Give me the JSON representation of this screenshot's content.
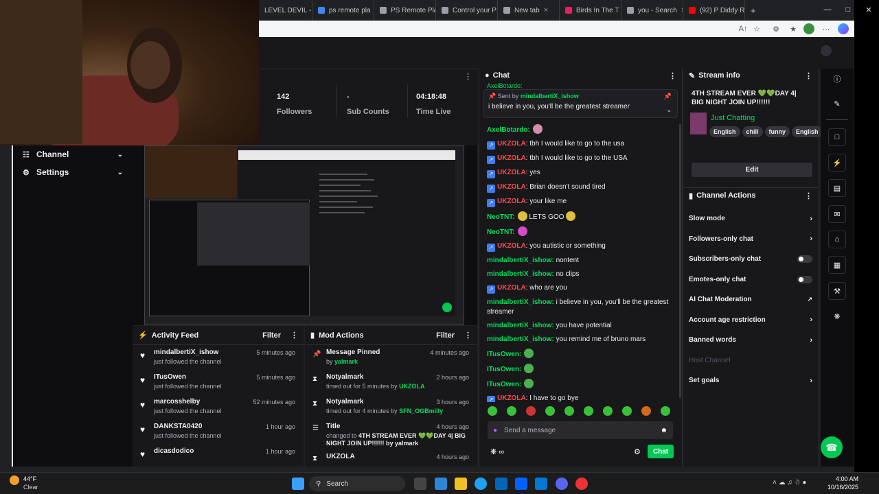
{
  "browser": {
    "tabs": [
      {
        "label": "LEVEL DEVIL -",
        "color": "#e5534b"
      },
      {
        "label": "ps remote pla",
        "color": "#4285f4"
      },
      {
        "label": "PS Remote Pla",
        "color": "#9aa0a6"
      },
      {
        "label": "Control your P",
        "color": "#9aa0a6"
      },
      {
        "label": "New tab",
        "color": "#9aa0a6"
      },
      {
        "label": "Birds In The T",
        "color": "#e91e63"
      },
      {
        "label": "you - Search",
        "color": "#9aa0a6"
      },
      {
        "label": "(92) P Diddy R",
        "color": "#ff0000"
      }
    ]
  },
  "stats": {
    "followers": {
      "value": "142",
      "label": "Followers"
    },
    "subs": {
      "value": "-",
      "label": "Sub Counts"
    },
    "time": {
      "value": "04:18:48",
      "label": "Time Live"
    }
  },
  "leftnav": {
    "channel": "Channel",
    "settings": "Settings"
  },
  "activity": {
    "title": "Activity Feed",
    "filter": "Filter",
    "items": [
      {
        "name": "mindalbertiX_ishow",
        "sub": "just followed the channel",
        "time": "5 minutes ago"
      },
      {
        "name": "ITusOwen",
        "sub": "just followed the channel",
        "time": "5 minutes ago"
      },
      {
        "name": "marcosshelby",
        "sub": "just followed the channel",
        "time": "52 minutes ago"
      },
      {
        "name": "DANKSTA0420",
        "sub": "just followed the channel",
        "time": "1 hour ago"
      },
      {
        "name": "dicasdodico",
        "sub": "",
        "time": "1 hour ago"
      }
    ]
  },
  "mod": {
    "title": "Mod Actions",
    "filter": "Filter",
    "items": [
      {
        "name": "Message Pinned",
        "pre": "by ",
        "who": "yalmark",
        "time": "4 minutes ago"
      },
      {
        "name": "Notyalmark",
        "pre": "timed out for 5 minutes by ",
        "who": "UKZOLA",
        "time": "2 hours ago"
      },
      {
        "name": "Notyalmark",
        "pre": "timed out for 4 minutes by ",
        "who": "SFN_OGBmilly",
        "time": "3 hours ago"
      },
      {
        "name": "Title",
        "pre": "changed to ",
        "who": "4TH STREAM EVER 💚💚DAY 4| BIG NIGHT JOIN UP!!!!!! by yalmark",
        "time": "4 hours ago"
      },
      {
        "name": "UKZOLA",
        "pre": "",
        "who": "",
        "time": "4 hours ago"
      }
    ]
  },
  "chat": {
    "title": "Chat",
    "pinned_by_label": "Sent by",
    "pinned_by": "mindalbertiX_ishow",
    "pinned_text": "i believe in you, you'll be the greatest streamer",
    "top_name": "AxelBotardo:",
    "messages": [
      {
        "user": "AxelBotardo:",
        "text": "",
        "style": "green"
      },
      {
        "user": "UKZOLA",
        "text": ": tbh I would like to go to the usa",
        "style": "red"
      },
      {
        "user": "UKZOLA",
        "text": ": tbh I would like to go to the USA",
        "style": "red"
      },
      {
        "user": "UKZOLA",
        "text": ": yes",
        "style": "red"
      },
      {
        "user": "UKZOLA",
        "text": ": Brian doesn't sound tired",
        "style": "red"
      },
      {
        "user": "UKZOLA",
        "text": ": your like me",
        "style": "red"
      },
      {
        "user": "NeoTNT:",
        "text": " LETS GOO ",
        "style": "green"
      },
      {
        "user": "NeoTNT:",
        "text": "",
        "style": "green"
      },
      {
        "user": "UKZOLA",
        "text": ": you autistic or something",
        "style": "red"
      },
      {
        "user": "mindalbertiX_ishow:",
        "text": " nontent",
        "style": "green"
      },
      {
        "user": "mindalbertiX_ishow:",
        "text": " no clips",
        "style": "green"
      },
      {
        "user": "UKZOLA",
        "text": ": who are you",
        "style": "red"
      },
      {
        "user": "mindalbertiX_ishow:",
        "text": " i believe in you, you'll be the greatest streamer",
        "style": "green"
      },
      {
        "user": "mindalbertiX_ishow:",
        "text": " you have potential",
        "style": "green"
      },
      {
        "user": "mindalbertiX_ishow:",
        "text": " you remind me of bruno mars",
        "style": "green"
      },
      {
        "user": "ITusOwen:",
        "text": "",
        "style": "green"
      },
      {
        "user": "ITusOwen:",
        "text": "",
        "style": "green"
      },
      {
        "user": "ITusOwen:",
        "text": "",
        "style": "green"
      },
      {
        "user": "UKZOLA",
        "text": ": I have to go bye",
        "style": "red"
      }
    ],
    "placeholder": "Send a message",
    "send": "Chat"
  },
  "info": {
    "title": "Stream info",
    "stream_title": "4TH STREAM EVER 💚💚DAY 4| BIG NIGHT JOIN UP!!!!!!",
    "category": "Just Chatting",
    "tags": [
      "English",
      "chill",
      "funny",
      "English"
    ],
    "edit": "Edit"
  },
  "actions": {
    "title": "Channel Actions",
    "items": [
      {
        "label": "Slow mode",
        "kind": "chevron"
      },
      {
        "label": "Followers-only chat",
        "kind": "chevron"
      },
      {
        "label": "Subscribers-only chat",
        "kind": "toggle"
      },
      {
        "label": "Emotes-only chat",
        "kind": "toggle"
      },
      {
        "label": "AI Chat Moderation",
        "kind": "ext"
      },
      {
        "label": "Account age restriction",
        "kind": "chevron"
      },
      {
        "label": "Banned words",
        "kind": "chevron"
      },
      {
        "label": "Host Channel",
        "kind": "disabled"
      },
      {
        "label": "Set goals",
        "kind": "chevron"
      }
    ]
  },
  "taskbar": {
    "weather_temp": "44°F",
    "weather_text": "Clear",
    "search": "Search",
    "time": "4:00 AM",
    "date": "10/16/2025"
  }
}
